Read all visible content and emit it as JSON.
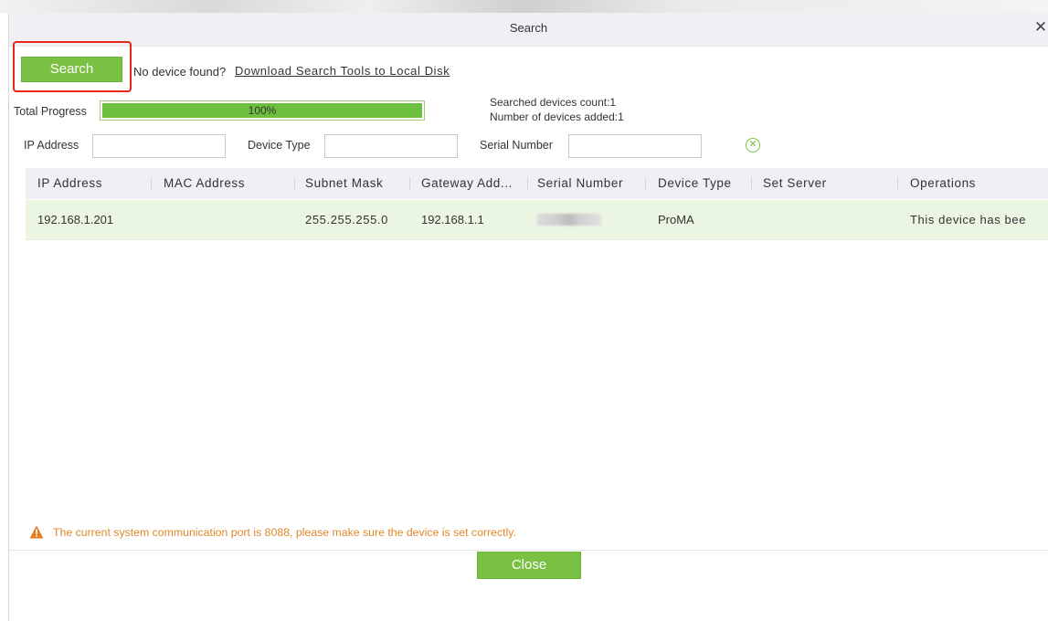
{
  "dialog": {
    "title": "Search",
    "close_icon": "close-icon",
    "close_symbol": "✕"
  },
  "toolbar": {
    "search_label": "Search",
    "no_device_text": "No device found?",
    "download_link": "Download Search Tools to Local Disk",
    "highlight_color": "#e8261b",
    "button_color": "#7ac143"
  },
  "progress": {
    "label": "Total Progress",
    "percent_text": "100%",
    "value": 1.0,
    "searched_count": "Searched devices count:1",
    "added_count": "Number of devices added:1"
  },
  "filters": {
    "ip_label": "IP Address",
    "ip_value": "",
    "type_label": "Device Type",
    "type_value": "",
    "serial_label": "Serial Number",
    "serial_value": "",
    "clear_icon": "clear-circle-icon"
  },
  "table": {
    "columns": [
      "IP Address",
      "MAC Address",
      "Subnet Mask",
      "Gateway Add...",
      "Serial Number",
      "Device Type",
      "Set Server",
      "Operations"
    ],
    "rows": [
      {
        "ip": "192.168.1.201",
        "mac": "",
        "subnet": "255.255.255.0",
        "gateway": "192.168.1.1",
        "serial": "",
        "device_type": "ProMA",
        "set_server": "",
        "operations": "This device has bee"
      }
    ]
  },
  "footer": {
    "warning_icon": "warning-triangle-icon",
    "warning_text": "The current system communication port is 8088, please make sure the device is set correctly.",
    "close_label": "Close"
  }
}
